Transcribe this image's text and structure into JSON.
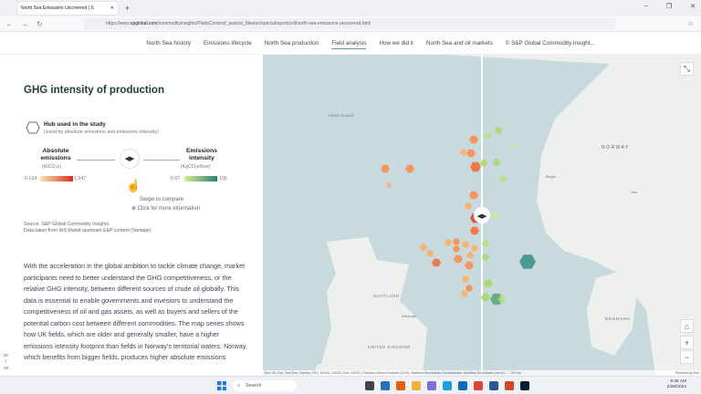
{
  "browser": {
    "tab_title": "North Sea Emissions Uncovered | S",
    "url_prefix": "https://www.",
    "url_domain": "spglobal.com",
    "url_path": "/commodityinsights/PlattsContent/_assets/_files/en/specialreports/oil/north-sea-emissions-uncovered.html"
  },
  "nav": {
    "items": [
      "North Sea history",
      "Emissions lifecycle",
      "North Sea production",
      "Field analysis",
      "How we did it",
      "North Sea and oil markets",
      "© S&P Global Commodity Insight..."
    ],
    "active": "Field analysis"
  },
  "panel": {
    "title": "GHG intensity of production",
    "hub_title": "Hub used in the study",
    "hub_sub": "(sized by absolute emissions and emissions intensity)",
    "abs_label": "Absolute emissions",
    "abs_unit": "(KtCO₂e)",
    "abs_min": "0.134",
    "abs_max": "1,547",
    "int_label": "Emissions intensity",
    "int_unit": "(KgCO₂e/boe)",
    "int_min": "0.07",
    "int_max": "156",
    "swipe": "Swipe to compare",
    "click": "Click for more information",
    "source1": "Source: S&P Global Commodity Insights",
    "source2": "Data taken from IHS Markit upstream E&P content (Vantage)",
    "paragraph": "With the acceleration in the global ambition to tackle climate change, market participants need to better understand the GHG competitiveness, or the relative GHG intensity, between different sources of crude oil globally.  This data is essential to enable governments and investors to understand the competitiveness of oil and gas assets, as well as buyers and sellers of the potential carbon cost between different commodities. The map series shows how UK fields, which are older and generally smaller, have a higher emissions intensity footprint than fields in Norway's territorial waters. Norway, which benefits from bigger fields, produces higher absolute emissions",
    "page_current": "02",
    "page_total": "08"
  },
  "colors": {
    "abs_low": "#fde1b8",
    "abs_high": "#d7301f",
    "int_low": "#d9ef8b",
    "int_high": "#2a7f7a"
  },
  "map": {
    "labels": {
      "norway": "NORWAY",
      "scotland": "SCOTLAND",
      "uk": "UNITED KINGDOM",
      "denmark": "DENMARK",
      "faroe": "FAROE ISLANDS",
      "bergen": "Bergen",
      "oslo": "Oslo",
      "edinburgh": "Edinburgh"
    },
    "attribution": "Esri UK, Esri, TomTom, Garmin, FAO, NOAA, USGS | Esri, USGS | Flanders Marine Institute (2019). Maritime Boundaries Geodatabase: Maritime Boundaries and Ex...",
    "scale": "200 km",
    "powered": "Powered by Esri"
  },
  "taskbar": {
    "search": "Search",
    "time": "9:36 AM",
    "date": "2/28/2024"
  }
}
